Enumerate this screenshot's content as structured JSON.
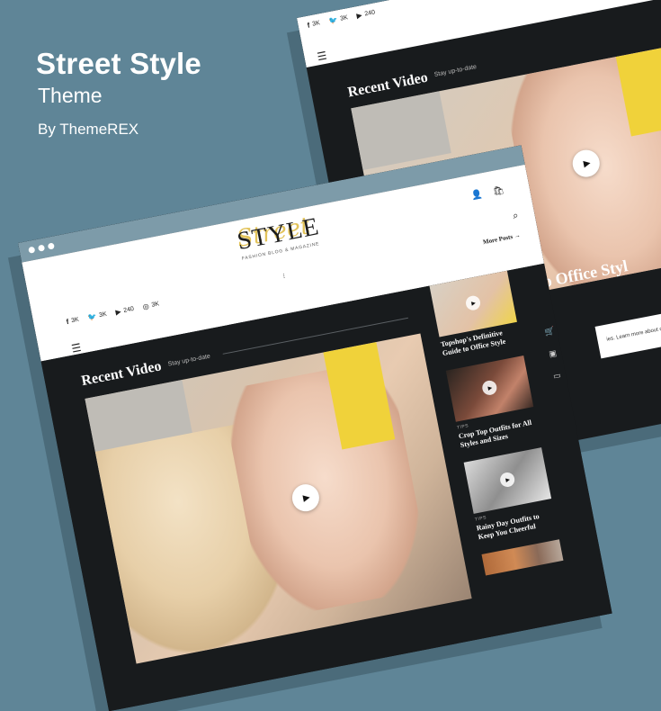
{
  "hero": {
    "title": "Street Style",
    "subtitle": "Theme",
    "byline": "By ThemeREX"
  },
  "colors": {
    "background": "#5f8597",
    "titlebar": "#7d9ba9",
    "dark": "#181b1d",
    "accent_yellow": "#f0d23a",
    "logo_gold": "#e2c35a"
  },
  "site": {
    "logo_script": "Street",
    "logo_main": "STYLE",
    "logo_tagline": "FASHION BLOG & MAGAZINE",
    "social": [
      {
        "icon": "facebook-icon",
        "glyph": "f",
        "count": "3K"
      },
      {
        "icon": "twitter-icon",
        "glyph": "🐦",
        "count": "3K"
      },
      {
        "icon": "youtube-icon",
        "glyph": "▶",
        "count": "240"
      },
      {
        "icon": "instagram-icon",
        "glyph": "◎",
        "count": "3K"
      }
    ],
    "more_posts": "More Posts →",
    "hamburger": "☰",
    "user_icon": "👤",
    "cart_icon": "🛍",
    "search_icon": "⌕",
    "center_marker": "⁝"
  },
  "video_section": {
    "title": "Recent Video",
    "subtitle": "Stay up-to-date",
    "play_glyph": "▶"
  },
  "side_posts": [
    {
      "category": "",
      "title": "",
      "thumb": "t1"
    },
    {
      "category": "",
      "title": "Topshop's Definitive Guide to Office Style",
      "thumb": "t2"
    },
    {
      "category": "TIPS",
      "title": "Crop Top Outfits for All Styles and Sizes",
      "thumb": "t3"
    },
    {
      "category": "TIPS",
      "title": "Rainy Day Outfits to Keep You Cheerful",
      "thumb": "t4"
    }
  ],
  "side_tools": [
    "🛒",
    "▣",
    "▭"
  ],
  "back_window": {
    "title_fragment": "uide to Office Styl",
    "cookie_text": "ies. Learn more about our use of"
  }
}
